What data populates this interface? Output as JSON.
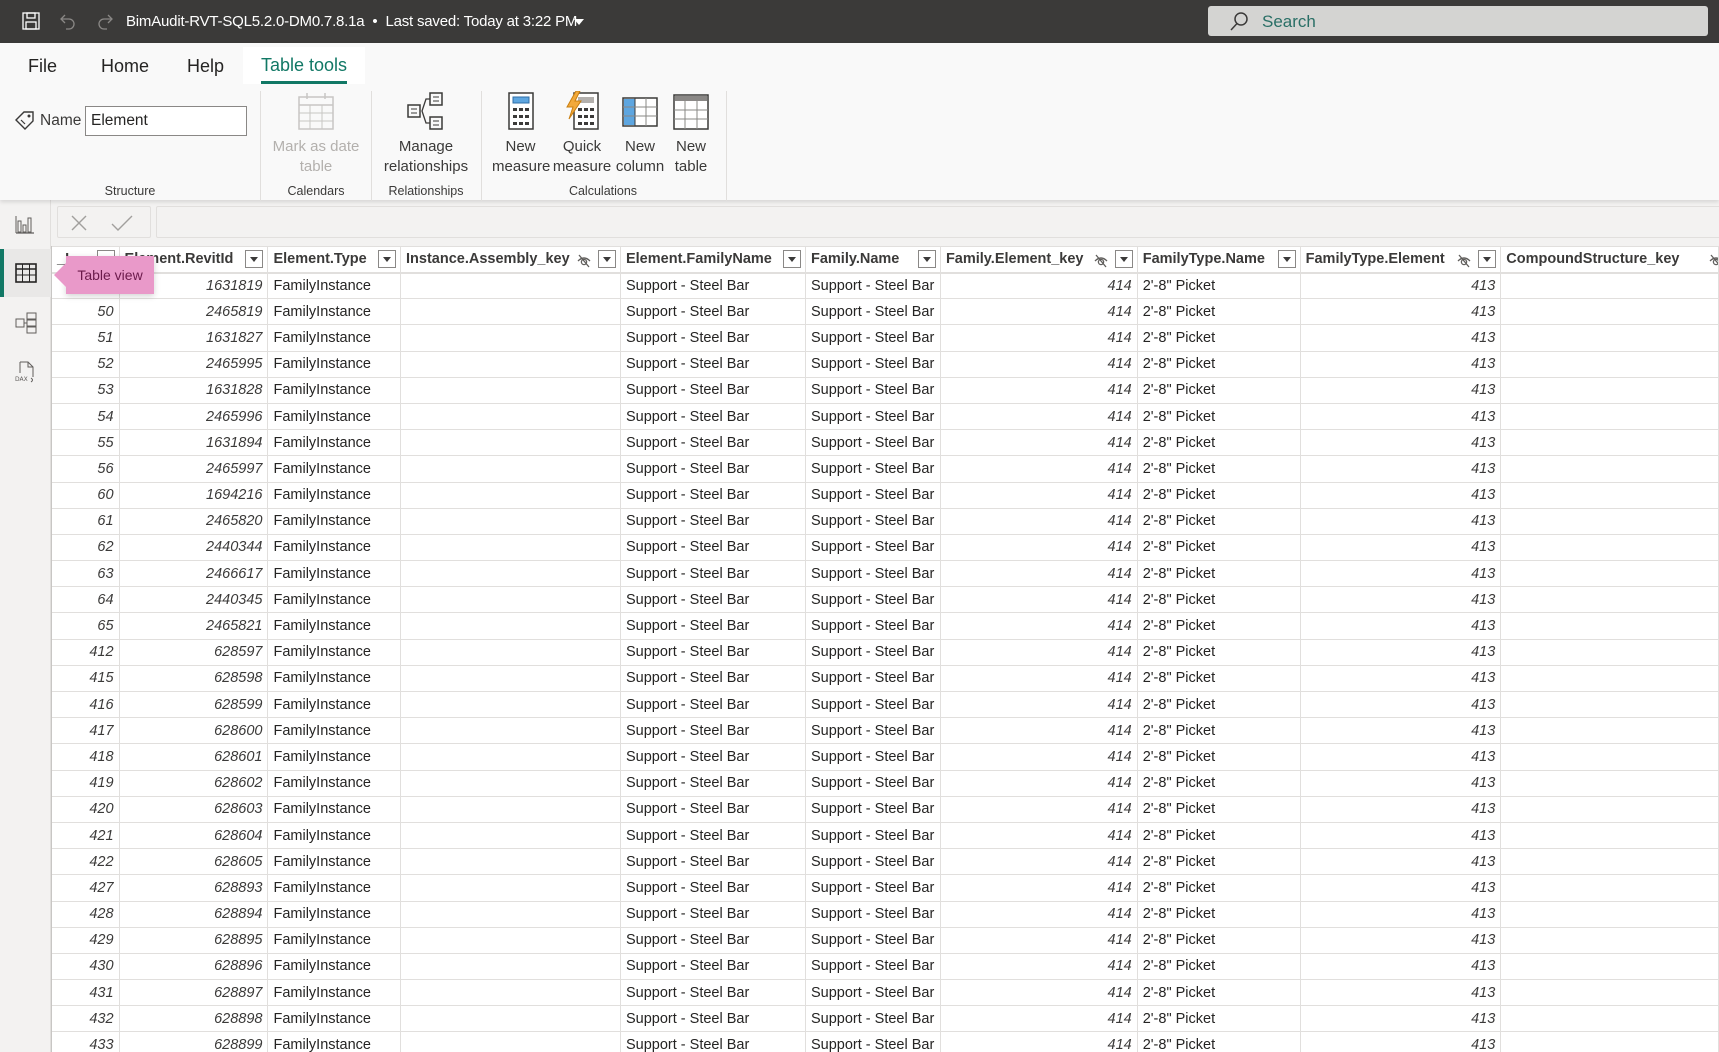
{
  "titlebar": {
    "document_title": "BimAudit-RVT-SQL5.2.0-DM0.7.8.1a",
    "separator": "•",
    "save_status": "Last saved: Today at 3:22 PM",
    "search_placeholder": "Search"
  },
  "ribbon": {
    "tabs": [
      {
        "label": "File",
        "active": false
      },
      {
        "label": "Home",
        "active": false
      },
      {
        "label": "Help",
        "active": false
      },
      {
        "label": "Table tools",
        "active": true
      }
    ],
    "structure": {
      "name_label": "Name",
      "name_value": "Element",
      "group_label": "Structure"
    },
    "calendars": {
      "mark_as_date_table_line1": "Mark as date",
      "mark_as_date_table_line2": "table",
      "group_label": "Calendars"
    },
    "relationships": {
      "manage_line1": "Manage",
      "manage_line2": "relationships",
      "group_label": "Relationships"
    },
    "calculations": {
      "buttons": [
        {
          "line1": "New",
          "line2": "measure"
        },
        {
          "line1": "Quick",
          "line2": "measure"
        },
        {
          "line1": "New",
          "line2": "column"
        },
        {
          "line1": "New",
          "line2": "table"
        }
      ],
      "group_label": "Calculations"
    }
  },
  "sidebar": {
    "items": [
      {
        "name": "Report view",
        "icon": "bar-chart-icon"
      },
      {
        "name": "Table view",
        "icon": "table-icon",
        "active": true
      },
      {
        "name": "Model view",
        "icon": "model-icon"
      },
      {
        "name": "DAX query view",
        "icon": "dax-icon"
      }
    ],
    "tooltip": "Table view"
  },
  "table": {
    "columns": [
      {
        "label": "_I",
        "hidden_icon": false
      },
      {
        "label": "Element.RevitId",
        "hidden_icon": false
      },
      {
        "label": "Element.Type",
        "hidden_icon": false
      },
      {
        "label": "Instance.Assembly_key",
        "hidden_icon": true
      },
      {
        "label": "Element.FamilyName",
        "hidden_icon": false
      },
      {
        "label": "Family.Name",
        "hidden_icon": false
      },
      {
        "label": "Family.Element_key",
        "hidden_icon": true
      },
      {
        "label": "FamilyType.Name",
        "hidden_icon": false
      },
      {
        "label": "FamilyType.Element",
        "hidden_icon": true
      },
      {
        "label": "CompoundStructure_key",
        "hidden_icon": true
      }
    ],
    "rows": [
      [
        "",
        "1631819",
        "FamilyInstance",
        "",
        "Support - Steel Bar",
        "Support - Steel Bar",
        "414",
        "2'-8\" Picket",
        "413",
        ""
      ],
      [
        "50",
        "2465819",
        "FamilyInstance",
        "",
        "Support - Steel Bar",
        "Support - Steel Bar",
        "414",
        "2'-8\" Picket",
        "413",
        ""
      ],
      [
        "51",
        "1631827",
        "FamilyInstance",
        "",
        "Support - Steel Bar",
        "Support - Steel Bar",
        "414",
        "2'-8\" Picket",
        "413",
        ""
      ],
      [
        "52",
        "2465995",
        "FamilyInstance",
        "",
        "Support - Steel Bar",
        "Support - Steel Bar",
        "414",
        "2'-8\" Picket",
        "413",
        ""
      ],
      [
        "53",
        "1631828",
        "FamilyInstance",
        "",
        "Support - Steel Bar",
        "Support - Steel Bar",
        "414",
        "2'-8\" Picket",
        "413",
        ""
      ],
      [
        "54",
        "2465996",
        "FamilyInstance",
        "",
        "Support - Steel Bar",
        "Support - Steel Bar",
        "414",
        "2'-8\" Picket",
        "413",
        ""
      ],
      [
        "55",
        "1631894",
        "FamilyInstance",
        "",
        "Support - Steel Bar",
        "Support - Steel Bar",
        "414",
        "2'-8\" Picket",
        "413",
        ""
      ],
      [
        "56",
        "2465997",
        "FamilyInstance",
        "",
        "Support - Steel Bar",
        "Support - Steel Bar",
        "414",
        "2'-8\" Picket",
        "413",
        ""
      ],
      [
        "60",
        "1694216",
        "FamilyInstance",
        "",
        "Support - Steel Bar",
        "Support - Steel Bar",
        "414",
        "2'-8\" Picket",
        "413",
        ""
      ],
      [
        "61",
        "2465820",
        "FamilyInstance",
        "",
        "Support - Steel Bar",
        "Support - Steel Bar",
        "414",
        "2'-8\" Picket",
        "413",
        ""
      ],
      [
        "62",
        "2440344",
        "FamilyInstance",
        "",
        "Support - Steel Bar",
        "Support - Steel Bar",
        "414",
        "2'-8\" Picket",
        "413",
        ""
      ],
      [
        "63",
        "2466617",
        "FamilyInstance",
        "",
        "Support - Steel Bar",
        "Support - Steel Bar",
        "414",
        "2'-8\" Picket",
        "413",
        ""
      ],
      [
        "64",
        "2440345",
        "FamilyInstance",
        "",
        "Support - Steel Bar",
        "Support - Steel Bar",
        "414",
        "2'-8\" Picket",
        "413",
        ""
      ],
      [
        "65",
        "2465821",
        "FamilyInstance",
        "",
        "Support - Steel Bar",
        "Support - Steel Bar",
        "414",
        "2'-8\" Picket",
        "413",
        ""
      ],
      [
        "412",
        "628597",
        "FamilyInstance",
        "",
        "Support - Steel Bar",
        "Support - Steel Bar",
        "414",
        "2'-8\" Picket",
        "413",
        ""
      ],
      [
        "415",
        "628598",
        "FamilyInstance",
        "",
        "Support - Steel Bar",
        "Support - Steel Bar",
        "414",
        "2'-8\" Picket",
        "413",
        ""
      ],
      [
        "416",
        "628599",
        "FamilyInstance",
        "",
        "Support - Steel Bar",
        "Support - Steel Bar",
        "414",
        "2'-8\" Picket",
        "413",
        ""
      ],
      [
        "417",
        "628600",
        "FamilyInstance",
        "",
        "Support - Steel Bar",
        "Support - Steel Bar",
        "414",
        "2'-8\" Picket",
        "413",
        ""
      ],
      [
        "418",
        "628601",
        "FamilyInstance",
        "",
        "Support - Steel Bar",
        "Support - Steel Bar",
        "414",
        "2'-8\" Picket",
        "413",
        ""
      ],
      [
        "419",
        "628602",
        "FamilyInstance",
        "",
        "Support - Steel Bar",
        "Support - Steel Bar",
        "414",
        "2'-8\" Picket",
        "413",
        ""
      ],
      [
        "420",
        "628603",
        "FamilyInstance",
        "",
        "Support - Steel Bar",
        "Support - Steel Bar",
        "414",
        "2'-8\" Picket",
        "413",
        ""
      ],
      [
        "421",
        "628604",
        "FamilyInstance",
        "",
        "Support - Steel Bar",
        "Support - Steel Bar",
        "414",
        "2'-8\" Picket",
        "413",
        ""
      ],
      [
        "422",
        "628605",
        "FamilyInstance",
        "",
        "Support - Steel Bar",
        "Support - Steel Bar",
        "414",
        "2'-8\" Picket",
        "413",
        ""
      ],
      [
        "427",
        "628893",
        "FamilyInstance",
        "",
        "Support - Steel Bar",
        "Support - Steel Bar",
        "414",
        "2'-8\" Picket",
        "413",
        ""
      ],
      [
        "428",
        "628894",
        "FamilyInstance",
        "",
        "Support - Steel Bar",
        "Support - Steel Bar",
        "414",
        "2'-8\" Picket",
        "413",
        ""
      ],
      [
        "429",
        "628895",
        "FamilyInstance",
        "",
        "Support - Steel Bar",
        "Support - Steel Bar",
        "414",
        "2'-8\" Picket",
        "413",
        ""
      ],
      [
        "430",
        "628896",
        "FamilyInstance",
        "",
        "Support - Steel Bar",
        "Support - Steel Bar",
        "414",
        "2'-8\" Picket",
        "413",
        ""
      ],
      [
        "431",
        "628897",
        "FamilyInstance",
        "",
        "Support - Steel Bar",
        "Support - Steel Bar",
        "414",
        "2'-8\" Picket",
        "413",
        ""
      ],
      [
        "432",
        "628898",
        "FamilyInstance",
        "",
        "Support - Steel Bar",
        "Support - Steel Bar",
        "414",
        "2'-8\" Picket",
        "413",
        ""
      ],
      [
        "433",
        "628899",
        "FamilyInstance",
        "",
        "Support - Steel Bar",
        "Support - Steel Bar",
        "414",
        "2'-8\" Picket",
        "413",
        ""
      ]
    ]
  },
  "colors": {
    "accent": "#117865",
    "titlebar": "#3b3a39",
    "tooltip": "#e999c9",
    "quick_measure_bolt": "#f2a93b",
    "column_highlight": "#5ea6e0"
  }
}
